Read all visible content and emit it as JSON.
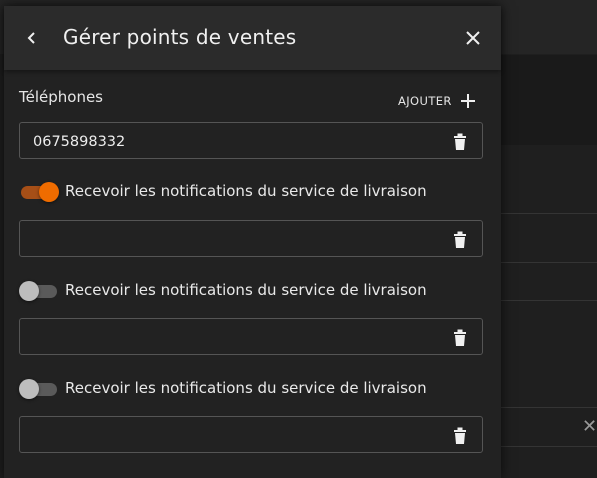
{
  "dialog": {
    "title": "Gérer points de ventes",
    "phones_label": "Téléphones",
    "add_label": "AJOUTER"
  },
  "phones": [
    {
      "value": "0675898332",
      "notify_label": "Recevoir les notifications du service de livraison",
      "notify_on": true
    },
    {
      "value": "",
      "notify_label": "Recevoir les notifications du service de livraison",
      "notify_on": false
    },
    {
      "value": "",
      "notify_label": "Recevoir les notifications du service de livraison",
      "notify_on": false
    },
    {
      "value": ""
    }
  ],
  "colors": {
    "accent": "#ef6c00",
    "accent_track": "#a64f17",
    "off_thumb": "#bdbdbd",
    "off_track": "#5a5a5a"
  }
}
